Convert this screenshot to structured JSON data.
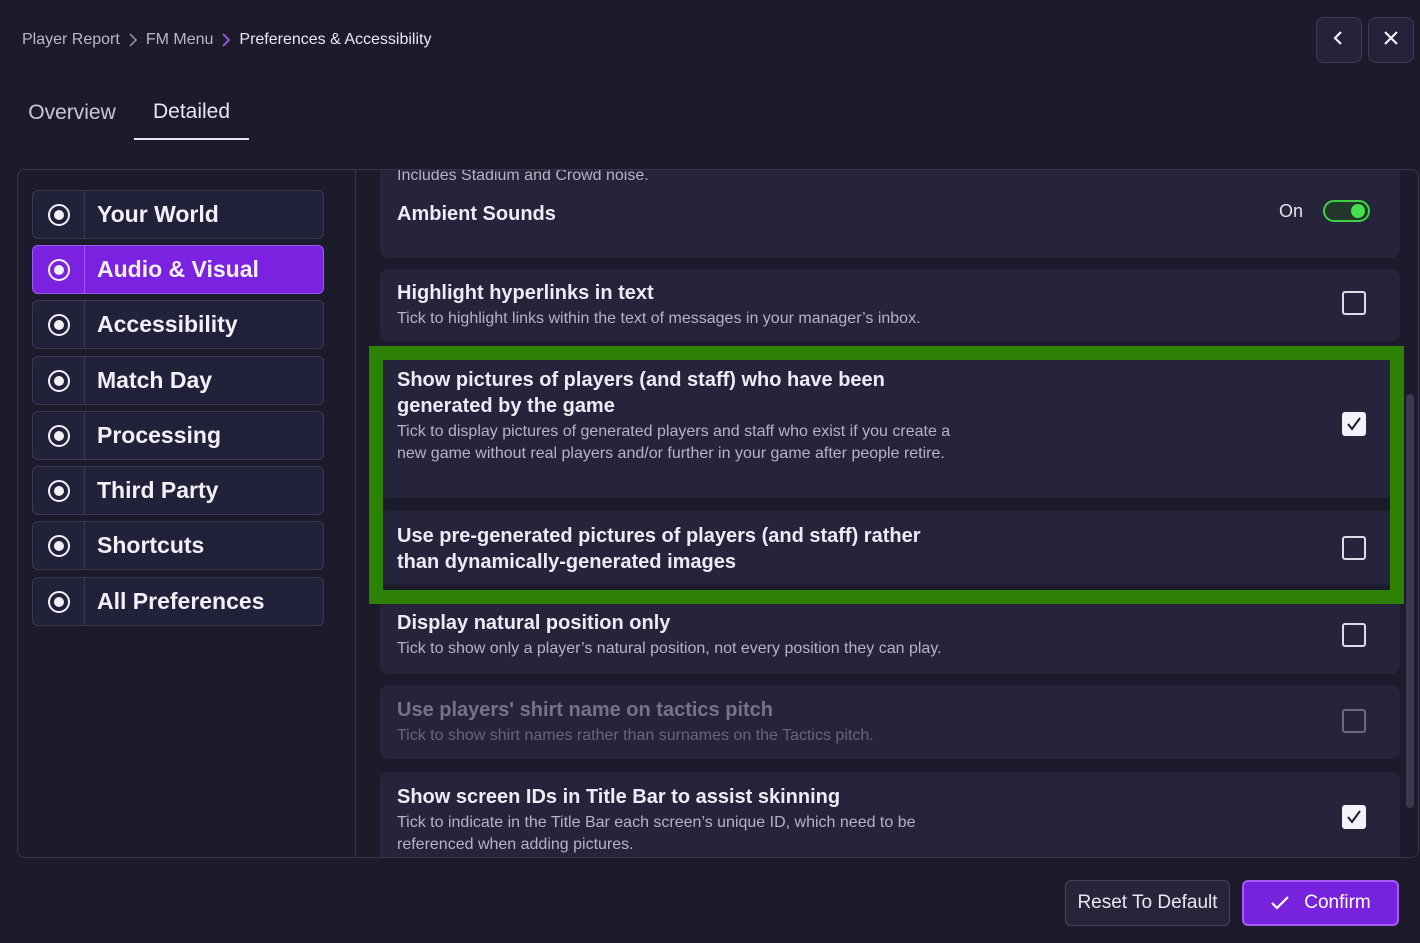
{
  "breadcrumb": {
    "items": [
      "Player Report",
      "FM Menu",
      "Preferences & Accessibility"
    ]
  },
  "top_buttons": {
    "back_icon": "chevron-left-icon",
    "close_icon": "close-icon"
  },
  "tabs": [
    {
      "label": "Overview",
      "active": false
    },
    {
      "label": "Detailed",
      "active": true
    }
  ],
  "sidebar": {
    "items": [
      {
        "label": "Your World",
        "active": false
      },
      {
        "label": "Audio & Visual",
        "active": true
      },
      {
        "label": "Accessibility",
        "active": false
      },
      {
        "label": "Match Day",
        "active": false
      },
      {
        "label": "Processing",
        "active": false
      },
      {
        "label": "Third Party",
        "active": false
      },
      {
        "label": "Shortcuts",
        "active": false
      },
      {
        "label": "All Preferences",
        "active": false
      }
    ]
  },
  "settings": {
    "ambient": {
      "partial_desc": "Includes Stadium and Crowd noise.",
      "title": "Ambient Sounds",
      "toggle_label": "On",
      "toggle_on": true
    },
    "items": [
      {
        "title": "Highlight hyperlinks in text",
        "desc": "Tick to highlight links within the text of messages in your manager’s inbox.",
        "checked": false,
        "disabled": false
      },
      {
        "title": "Show pictures of players (and staff) who have been generated by the game",
        "desc": "Tick to display pictures of generated players and staff who exist if you create a new game without real players and/or further in your game after people retire.",
        "checked": true,
        "disabled": false
      },
      {
        "title": "Use pre-generated pictures of players (and staff) rather than dynamically-generated images",
        "desc": "",
        "checked": false,
        "disabled": false
      },
      {
        "title": "Display natural position only",
        "desc": "Tick to show only a player’s natural position, not every position they can play.",
        "checked": false,
        "disabled": false
      },
      {
        "title": "Use players' shirt name on tactics pitch",
        "desc": "Tick to show shirt names rather than surnames on the Tactics pitch.",
        "checked": false,
        "disabled": true
      },
      {
        "title": "Show screen IDs in Title Bar to assist skinning",
        "desc": "Tick to indicate in the Title Bar each screen’s unique ID, which need to be referenced when adding pictures.",
        "checked": true,
        "disabled": false
      }
    ]
  },
  "footer": {
    "reset_label": "Reset To Default",
    "confirm_label": "Confirm"
  },
  "colors": {
    "accent": "#7722dd",
    "highlight": "#2d8205",
    "toggle_on": "#46e04c",
    "background": "#1c1b2b"
  }
}
